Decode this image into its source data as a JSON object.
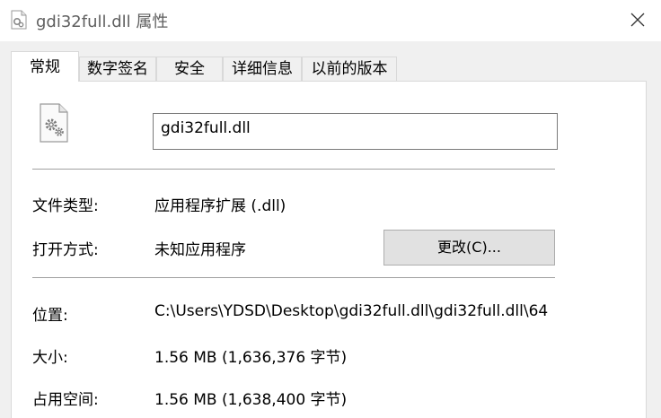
{
  "window": {
    "title": "gdi32full.dll 属性",
    "close_glyph": "✕"
  },
  "tabs": [
    {
      "label": "常规",
      "active": true
    },
    {
      "label": "数字签名",
      "active": false
    },
    {
      "label": "安全",
      "active": false
    },
    {
      "label": "详细信息",
      "active": false
    },
    {
      "label": "以前的版本",
      "active": false
    }
  ],
  "general": {
    "file_name": "gdi32full.dll",
    "file_type_label": "文件类型:",
    "file_type_value": "应用程序扩展 (.dll)",
    "opens_with_label": "打开方式:",
    "opens_with_value": "未知应用程序",
    "change_button_label": "更改(C)...",
    "location_label": "位置:",
    "location_value": "C:\\Users\\YDSD\\Desktop\\gdi32full.dll\\gdi32full.dll\\64",
    "size_label": "大小:",
    "size_value": "1.56 MB (1,636,376 字节)",
    "size_on_disk_label": "占用空间:",
    "size_on_disk_value": "1.56 MB (1,638,400 字节)"
  },
  "icons": {
    "title_icon": "dll-file-icon",
    "file_icon": "gear-file-icon",
    "close_icon": "close-icon"
  },
  "colors": {
    "title_text": "#5f5f5f",
    "tab_strip": "#f0f0f0",
    "button_face": "#e1e1e1"
  }
}
